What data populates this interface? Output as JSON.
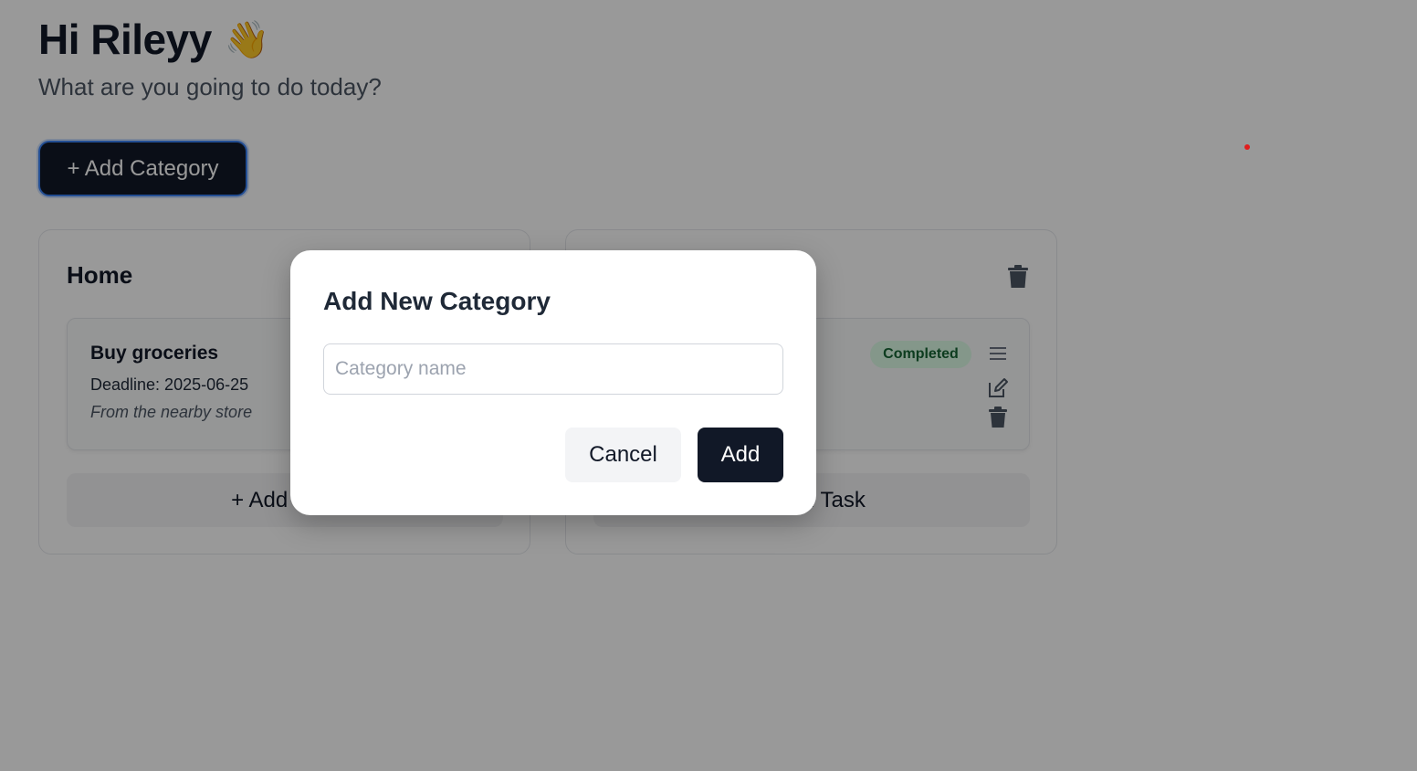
{
  "header": {
    "greeting": "Hi Rileyy",
    "wave_emoji": "👋",
    "subtitle": "What are you going to do today?"
  },
  "toolbar": {
    "add_category_label": "+ Add Category"
  },
  "categories": [
    {
      "title": "Home",
      "task": {
        "title": "Buy groceries",
        "deadline": "Deadline: 2025-06-25",
        "note": "From the nearby store"
      },
      "add_task_label": "+ Add Task"
    },
    {
      "title": "",
      "task": {
        "status": "Completed"
      },
      "add_task_label": "+ Add Task"
    }
  ],
  "modal": {
    "title": "Add New Category",
    "input_placeholder": "Category name",
    "input_value": "",
    "cancel_label": "Cancel",
    "add_label": "Add"
  },
  "colors": {
    "primary": "#111827",
    "focus_ring": "#3b82f6",
    "status_completed_bg": "#dcfce7",
    "status_completed_text": "#166534",
    "overlay": "rgba(0,0,0,0.4)"
  },
  "icons": [
    "waving-hand-icon",
    "trash-icon",
    "menu-icon",
    "edit-icon"
  ]
}
